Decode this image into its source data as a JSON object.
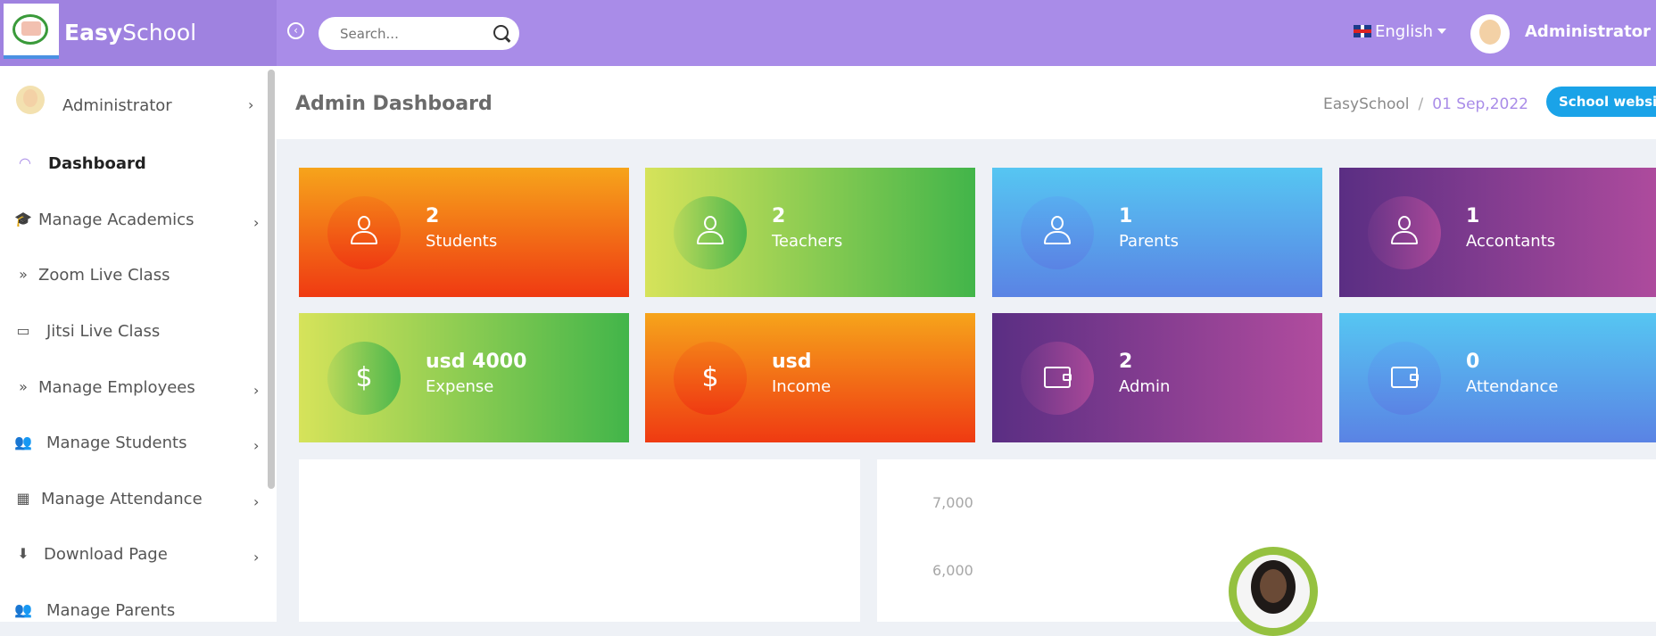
{
  "app": {
    "brand_bold": "Easy",
    "brand_rest": "School",
    "search_placeholder": "Search...",
    "language": "English",
    "user_name": "Administrator"
  },
  "sidebar": {
    "items": [
      {
        "label": "Administrator",
        "icon": "user-avatar-icon",
        "has_chevron": true
      },
      {
        "label": "Dashboard",
        "icon": "speedometer-icon",
        "has_chevron": false
      },
      {
        "label": "Manage Academics",
        "icon": "graduation-cap-icon",
        "has_chevron": true
      },
      {
        "label": "Zoom Live Class",
        "icon": "double-chevron-right-icon",
        "has_chevron": false
      },
      {
        "label": "Jitsi Live Class",
        "icon": "laptop-icon",
        "has_chevron": false
      },
      {
        "label": "Manage Employees",
        "icon": "double-chevron-right-icon",
        "has_chevron": true
      },
      {
        "label": "Manage Students",
        "icon": "users-icon",
        "has_chevron": true
      },
      {
        "label": "Manage Attendance",
        "icon": "building-icon",
        "has_chevron": true
      },
      {
        "label": "Download Page",
        "icon": "download-icon",
        "has_chevron": true
      },
      {
        "label": "Manage Parents",
        "icon": "users-icon",
        "has_chevron": false
      }
    ]
  },
  "header": {
    "title": "Admin Dashboard",
    "breadcrumb_home": "EasySchool",
    "breadcrumb_sep": "/",
    "date": "01 Sep,2022",
    "website_button": "School website"
  },
  "cards": [
    {
      "value": "2",
      "label": "Students",
      "icon": "user-icon",
      "theme": "orange"
    },
    {
      "value": "2",
      "label": "Teachers",
      "icon": "user-icon",
      "theme": "green"
    },
    {
      "value": "1",
      "label": "Parents",
      "icon": "user-icon",
      "theme": "blue"
    },
    {
      "value": "1",
      "label": "Accontants",
      "icon": "user-icon",
      "theme": "purple"
    },
    {
      "value": "usd 4000",
      "label": "Expense",
      "icon": "dollar-icon",
      "theme": "green"
    },
    {
      "value": "usd",
      "label": "Income",
      "icon": "dollar-icon",
      "theme": "orange"
    },
    {
      "value": "2",
      "label": "Admin",
      "icon": "wallet-icon",
      "theme": "purple"
    },
    {
      "value": "0",
      "label": "Attendance",
      "icon": "wallet-icon",
      "theme": "blue"
    }
  ],
  "chart": {
    "y_ticks": [
      "7,000",
      "6,000"
    ]
  },
  "colors": {
    "topbar": "#a98ce8",
    "accent_blue": "#1aa3e8"
  }
}
